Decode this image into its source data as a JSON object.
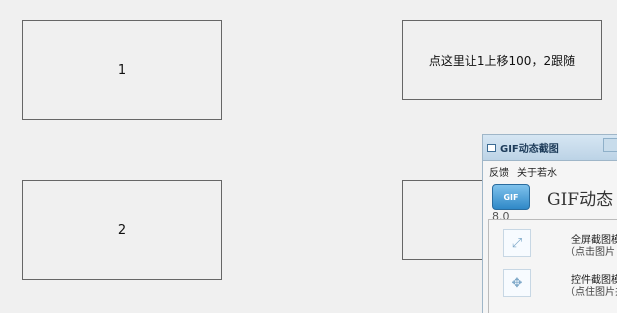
{
  "boxes": {
    "box1_label": "1",
    "box2_label": "2",
    "box3_label": "点这里让1上移100，2跟随",
    "box4_label": ""
  },
  "gif_window": {
    "title": "GIF动态截图",
    "menu": [
      "反馈",
      "关于若水"
    ],
    "logo_text": "GIF",
    "header_title": "GIF动态",
    "version": "8.0",
    "rows": [
      {
        "title": "全屏截图模",
        "subtitle": "（点击图片"
      },
      {
        "title": "控件截图模",
        "subtitle": "（点住图片并"
      }
    ]
  },
  "icons": [
    "gif-window-icon",
    "fullscreen-capture-icon",
    "control-capture-icon"
  ]
}
